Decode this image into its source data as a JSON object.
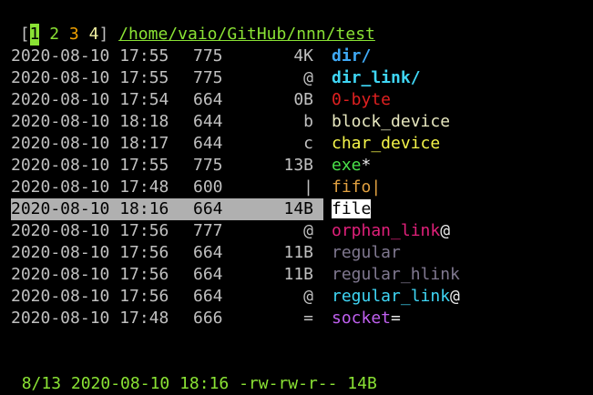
{
  "tabbar": {
    "open_bracket": "[",
    "tabs": [
      {
        "label": "1",
        "color": "#8ae234",
        "active": true
      },
      {
        "label": "2",
        "color": "#8ae234"
      },
      {
        "label": "3",
        "color": "#f0a000"
      },
      {
        "label": "4",
        "color": "#f0f0a0"
      }
    ],
    "close_bracket": "]",
    "path": "/home/vaio/GitHub/nnn/test",
    "path_color": "#8ae234"
  },
  "files": [
    {
      "date": "2020-08-10 17:55",
      "perm": "775",
      "size": "4K",
      "name": "dir",
      "suffix": "/",
      "color": "#3fa9f5",
      "bold": true
    },
    {
      "date": "2020-08-10 17:55",
      "perm": "775",
      "size": "@",
      "name": "dir_link",
      "suffix": "/",
      "color": "#3fd6f5",
      "bold": true
    },
    {
      "date": "2020-08-10 17:54",
      "perm": "664",
      "size": "0B",
      "name": "0-byte",
      "suffix": "",
      "color": "#e02020"
    },
    {
      "date": "2020-08-10 18:18",
      "perm": "644",
      "size": "b",
      "name": "block_device",
      "suffix": "",
      "color": "#e8e8c0"
    },
    {
      "date": "2020-08-10 18:17",
      "perm": "644",
      "size": "c",
      "name": "char_device",
      "suffix": "",
      "color": "#f5f54a"
    },
    {
      "date": "2020-08-10 17:55",
      "perm": "775",
      "size": "13B",
      "name": "exe",
      "suffix": "*",
      "color": "#4ae24a"
    },
    {
      "date": "2020-08-10 17:48",
      "perm": "600",
      "size": "|",
      "name": "fifo",
      "suffix": "|",
      "color": "#e0a040"
    },
    {
      "date": "2020-08-10 18:16",
      "perm": "664",
      "size": "14B",
      "name": "file",
      "suffix": "",
      "color": "#000000",
      "selected": true
    },
    {
      "date": "2020-08-10 17:56",
      "perm": "777",
      "size": "@",
      "name": "orphan_link",
      "suffix": "@",
      "color": "#e0207a"
    },
    {
      "date": "2020-08-10 17:56",
      "perm": "664",
      "size": "11B",
      "name": "regular",
      "suffix": "",
      "color": "#807890"
    },
    {
      "date": "2020-08-10 17:56",
      "perm": "664",
      "size": "11B",
      "name": "regular_hlink",
      "suffix": "",
      "color": "#807890"
    },
    {
      "date": "2020-08-10 17:56",
      "perm": "664",
      "size": "@",
      "name": "regular_link",
      "suffix": "@",
      "color": "#3fd6f5"
    },
    {
      "date": "2020-08-10 17:48",
      "perm": "666",
      "size": "=",
      "name": "socket",
      "suffix": "=",
      "color": "#c060f0"
    }
  ],
  "colors": {
    "meta_text": "#c0c0c0",
    "status_text": "#8ae234",
    "cursor_bar": "#b0b0b0"
  },
  "status": {
    "text": "8/13 2020-08-10 18:16 -rw-rw-r-- 14B"
  }
}
